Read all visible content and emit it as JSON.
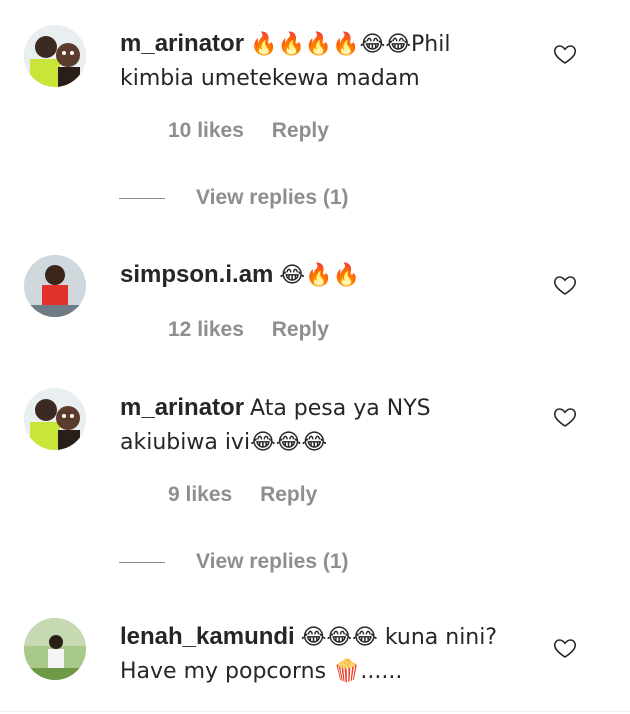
{
  "comments": [
    {
      "username": "m_arinator",
      "text": "🔥🔥🔥🔥😂😂Phil kimbia umetekewa madam",
      "likes": "10 likes",
      "reply": "Reply",
      "view_replies": "View replies (1)"
    },
    {
      "username": "simpson.i.am",
      "text": "😂🔥🔥",
      "likes": "12 likes",
      "reply": "Reply"
    },
    {
      "username": "m_arinator",
      "text": "Ata pesa ya NYS akiubiwa ivi😂😂😂",
      "likes": "9 likes",
      "reply": "Reply",
      "view_replies": "View replies (1)"
    },
    {
      "username": "lenah_kamundi",
      "text": "😂😂😂 kuna nini? Have my popcorns 🍿......"
    }
  ],
  "icons": {
    "like": "heart-outline-icon"
  },
  "colors": {
    "text": "#262626",
    "secondary": "#8e8e8e"
  }
}
